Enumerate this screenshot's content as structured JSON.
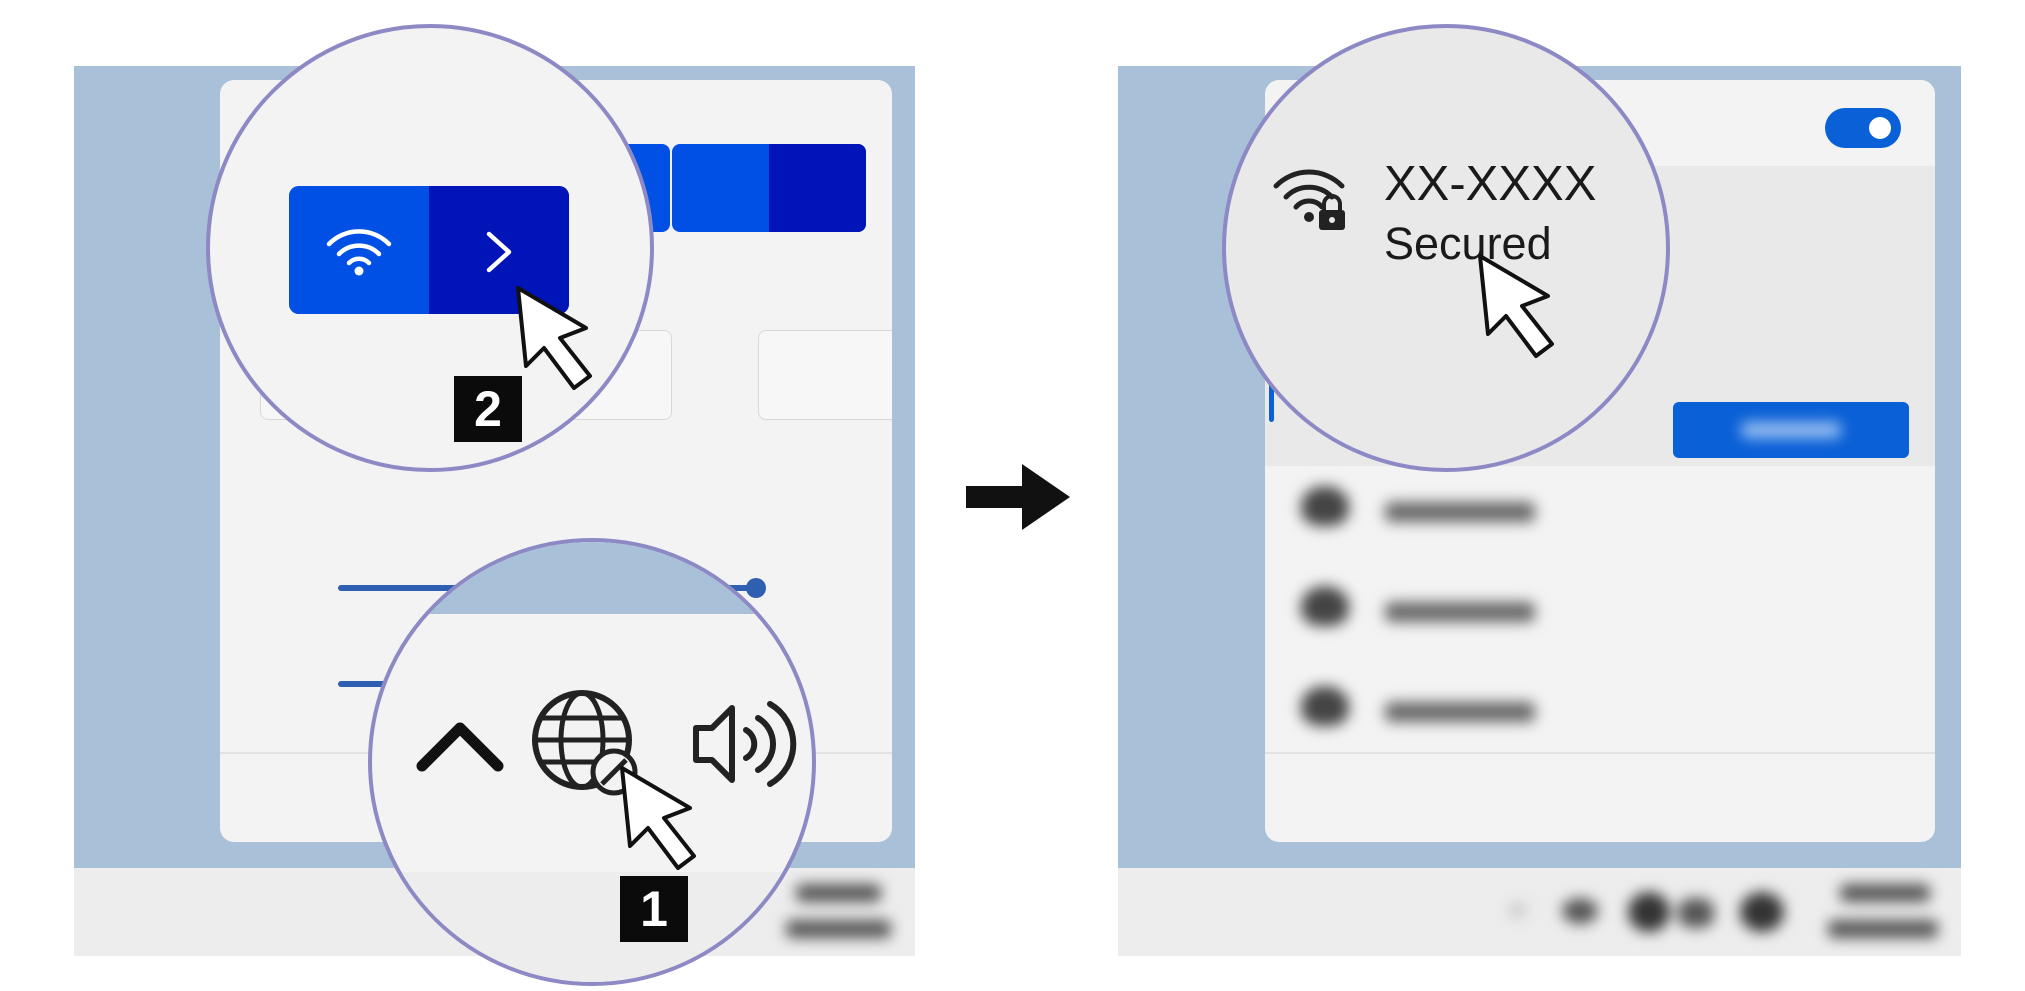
{
  "left_panel": {
    "magnifier_top": {
      "wifi_tile": {
        "wifi_icon": "wifi-icon",
        "expand_icon": "chevron-right-icon"
      },
      "step_badge": "2"
    },
    "magnifier_bottom": {
      "tray_icons": [
        "chevron-up-icon",
        "globe-no-internet-icon",
        "speaker-icon"
      ],
      "step_badge": "1"
    }
  },
  "arrow": "right-arrow-icon",
  "right_panel": {
    "network": {
      "name": "XX-XXXX",
      "status": "Secured",
      "icon": "wifi-lock-icon"
    },
    "toggle_on": true
  },
  "colors": {
    "desktop": "#a8c1d8",
    "flyout": "#f3f3f4",
    "tile_blue": "#0050e6",
    "tile_dark": "#0014b8",
    "magnifier_border": "#8c89c4",
    "connect_button": "#0a60d6"
  }
}
